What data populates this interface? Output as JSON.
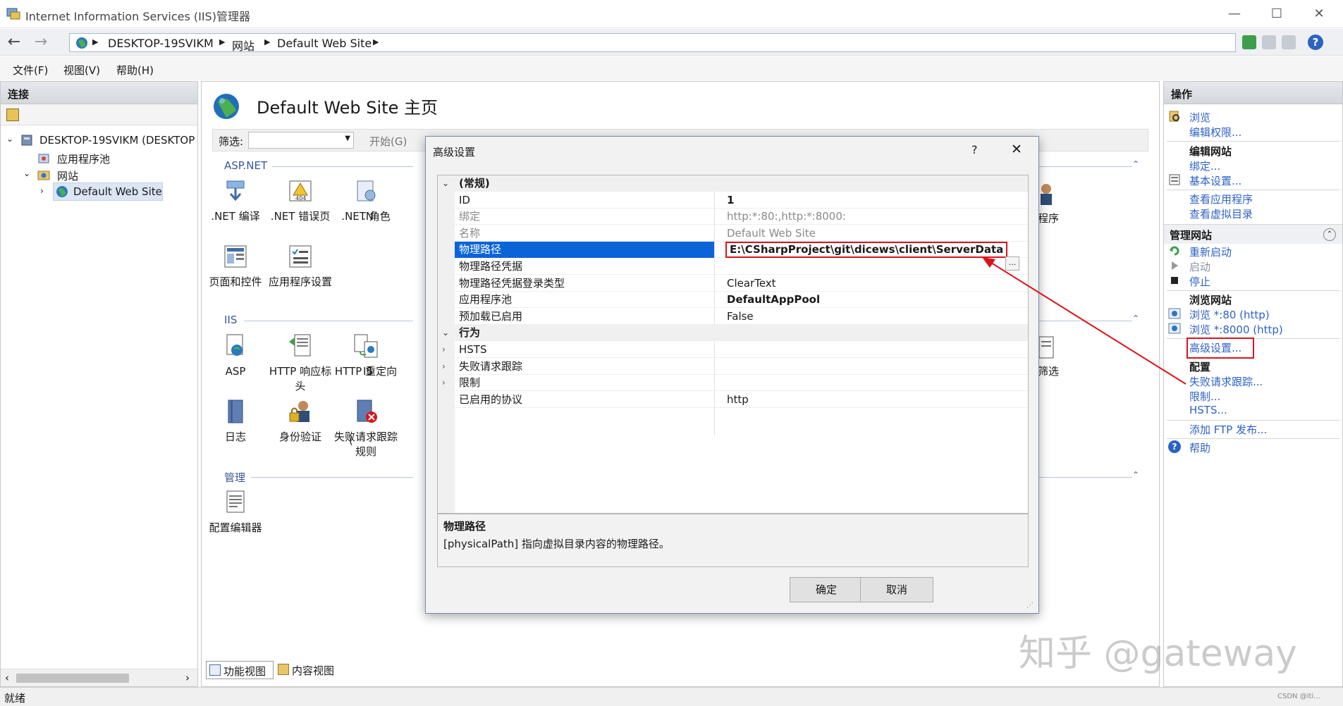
{
  "window": {
    "title": "Internet Information Services (IIS)管理器"
  },
  "address": {
    "crumbs": [
      "DESKTOP-19SVIKM",
      "网站",
      "Default Web Site"
    ]
  },
  "menu": [
    "文件(F)",
    "视图(V)",
    "帮助(H)"
  ],
  "connections": {
    "header": "连接",
    "tree": [
      {
        "label": "DESKTOP-19SVIKM (DESKTOP"
      },
      {
        "label": "应用程序池"
      },
      {
        "label": "网站"
      },
      {
        "label": "Default Web Site"
      }
    ]
  },
  "home": {
    "title": "Default Web Site 主页",
    "filter_label": "筛选:",
    "start_label": "开始(G)",
    "groups": {
      "aspnet": "ASP.NET",
      "iis": "IIS",
      "manage": "管理"
    },
    "aspnet_features": [
      ".NET 编译",
      ".NET 错误页",
      ".NET 角色",
      ".N",
      "页面和控件",
      "应用程序设置"
    ],
    "iis_features": [
      "ASP",
      "HTTP 响应标头",
      "HTTP 重定向",
      "IS",
      "日志",
      "身份验证",
      "失败请求跟踪规则"
    ],
    "right_partial": [
      "程序",
      "筛选"
    ],
    "manage_features": [
      "配置编辑器"
    ],
    "view_tabs": [
      "功能视图",
      "内容视图"
    ]
  },
  "actions": {
    "header": "操作",
    "browse": "浏览",
    "edit_perms": "编辑权限...",
    "edit_site_title": "编辑网站",
    "bindings": "绑定...",
    "basic_settings": "基本设置...",
    "view_apps": "查看应用程序",
    "view_vdirs": "查看虚拟目录",
    "manage_title": "管理网站",
    "restart": "重新启动",
    "start": "启动",
    "stop": "停止",
    "browse_site_title": "浏览网站",
    "browse_80": "浏览 *:80 (http)",
    "browse_8000": "浏览 *:8000 (http)",
    "advanced": "高级设置...",
    "config_title": "配置",
    "failed_req": "失败请求跟踪...",
    "limits": "限制...",
    "hsts": "HSTS...",
    "ftp": "添加 FTP 发布...",
    "help": "帮助"
  },
  "dialog": {
    "title": "高级设置",
    "help_glyph": "?",
    "rows": [
      {
        "key": "(常规)",
        "val": "",
        "type": "category",
        "expander": "⌄"
      },
      {
        "key": "ID",
        "val": "1",
        "bold": true
      },
      {
        "key": "绑定",
        "val": "http:*:80:,http:*:8000:",
        "greyed": true
      },
      {
        "key": "名称",
        "val": "Default Web Site",
        "greyed": true
      },
      {
        "key": "物理路径",
        "val": "E:\\CSharpProject\\git\\dicews\\client\\ServerData",
        "selected": true
      },
      {
        "key": "物理路径凭据",
        "val": ""
      },
      {
        "key": "物理路径凭据登录类型",
        "val": "ClearText"
      },
      {
        "key": "应用程序池",
        "val": "DefaultAppPool",
        "bold": true
      },
      {
        "key": "预加载已启用",
        "val": "False"
      },
      {
        "key": "行为",
        "val": "",
        "type": "category",
        "expander": "⌄"
      },
      {
        "key": "HSTS",
        "val": "",
        "expander": "›"
      },
      {
        "key": "失败请求跟踪",
        "val": "",
        "expander": "›"
      },
      {
        "key": "限制",
        "val": "",
        "expander": "›"
      },
      {
        "key": "已启用的协议",
        "val": "http"
      }
    ],
    "browse_btn": "...",
    "desc_title": "物理路径",
    "desc_text": "[physicalPath] 指向虚拟目录内容的物理路径。",
    "ok": "确定",
    "cancel": "取消"
  },
  "status": {
    "text": "就绪"
  },
  "watermark": "知乎 @gateway",
  "corner_mark": "CSDN @iti...",
  "colors": {
    "selection": "#0a64d8",
    "link": "#2f62c7",
    "highlight_box": "#d9141a"
  }
}
